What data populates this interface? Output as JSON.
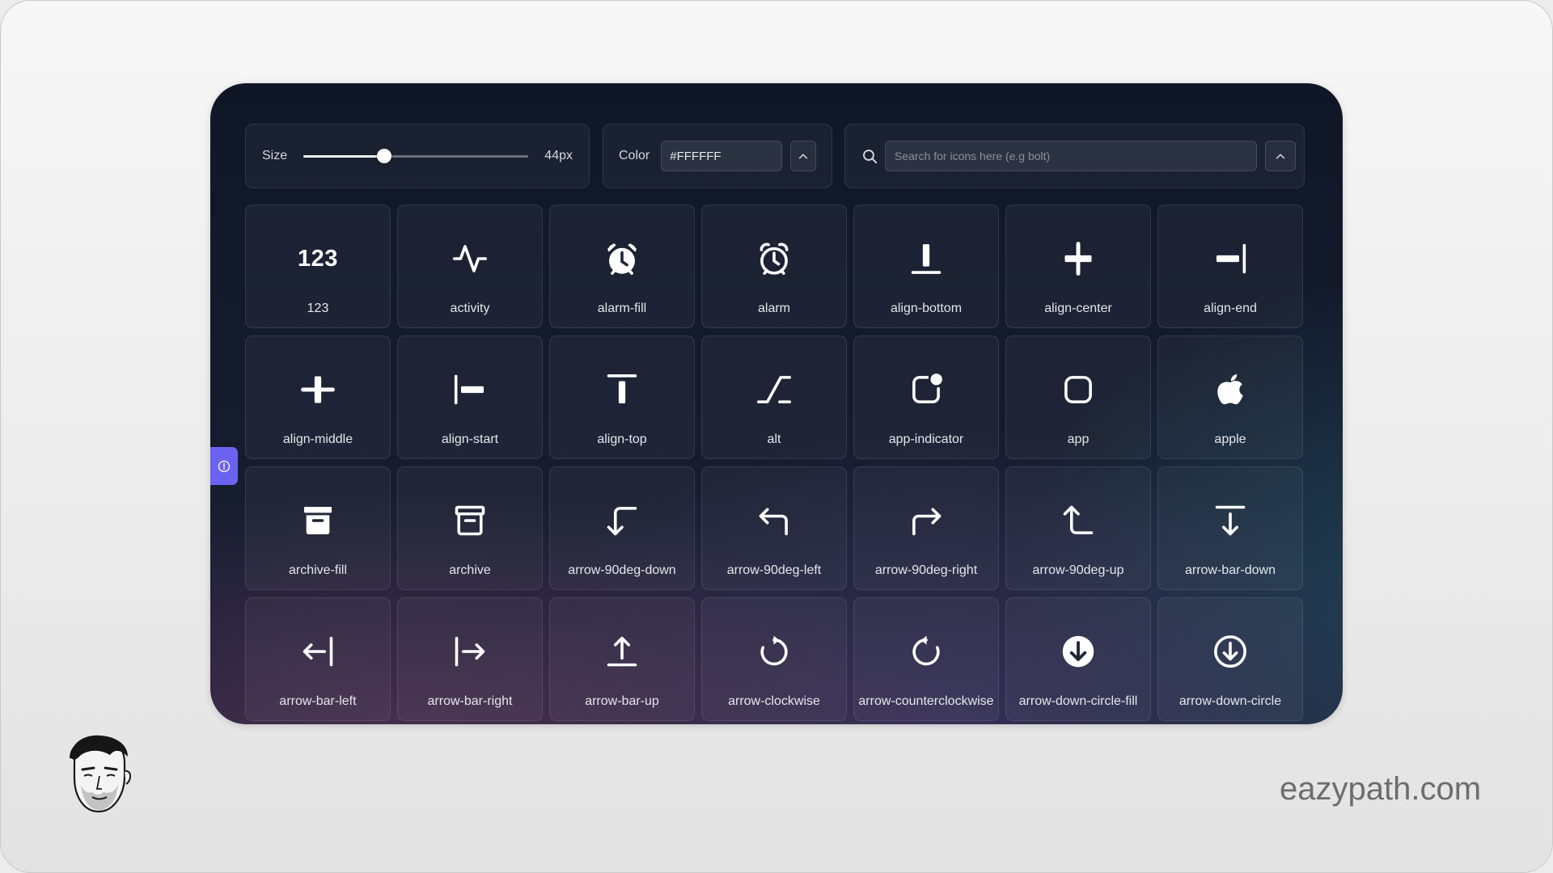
{
  "controls": {
    "size_label": "Size",
    "size_value_text": "44px",
    "size_fraction": 0.36,
    "color_label": "Color",
    "color_value": "#FFFFFF",
    "search_placeholder": "Search for icons here (e.g bolt)"
  },
  "icons": [
    {
      "label": "123",
      "icon": "123-icon"
    },
    {
      "label": "activity",
      "icon": "activity-icon"
    },
    {
      "label": "alarm-fill",
      "icon": "alarm-fill-icon"
    },
    {
      "label": "alarm",
      "icon": "alarm-icon"
    },
    {
      "label": "align-bottom",
      "icon": "align-bottom-icon"
    },
    {
      "label": "align-center",
      "icon": "align-center-icon"
    },
    {
      "label": "align-end",
      "icon": "align-end-icon"
    },
    {
      "label": "align-middle",
      "icon": "align-middle-icon"
    },
    {
      "label": "align-start",
      "icon": "align-start-icon"
    },
    {
      "label": "align-top",
      "icon": "align-top-icon"
    },
    {
      "label": "alt",
      "icon": "alt-icon"
    },
    {
      "label": "app-indicator",
      "icon": "app-indicator-icon"
    },
    {
      "label": "app",
      "icon": "app-icon"
    },
    {
      "label": "apple",
      "icon": "apple-icon"
    },
    {
      "label": "archive-fill",
      "icon": "archive-fill-icon"
    },
    {
      "label": "archive",
      "icon": "archive-icon"
    },
    {
      "label": "arrow-90deg-down",
      "icon": "arrow-90deg-down-icon"
    },
    {
      "label": "arrow-90deg-left",
      "icon": "arrow-90deg-left-icon"
    },
    {
      "label": "arrow-90deg-right",
      "icon": "arrow-90deg-right-icon"
    },
    {
      "label": "arrow-90deg-up",
      "icon": "arrow-90deg-up-icon"
    },
    {
      "label": "arrow-bar-down",
      "icon": "arrow-bar-down-icon"
    },
    {
      "label": "arrow-bar-left",
      "icon": "arrow-bar-left-icon"
    },
    {
      "label": "arrow-bar-right",
      "icon": "arrow-bar-right-icon"
    },
    {
      "label": "arrow-bar-up",
      "icon": "arrow-bar-up-icon"
    },
    {
      "label": "arrow-clockwise",
      "icon": "arrow-clockwise-icon"
    },
    {
      "label": "arrow-counterclockwise",
      "icon": "arrow-counterclockwise-icon"
    },
    {
      "label": "arrow-down-circle-fill",
      "icon": "arrow-down-circle-fill-icon"
    },
    {
      "label": "arrow-down-circle",
      "icon": "arrow-down-circle-icon"
    }
  ],
  "watermark": "eazypath.com",
  "colors": {
    "accent": "#6b63f0",
    "icon": "#FFFFFF",
    "app_bg": "#121a2b",
    "page_bg": "#ececec",
    "watermark": "#6d6d6d"
  }
}
